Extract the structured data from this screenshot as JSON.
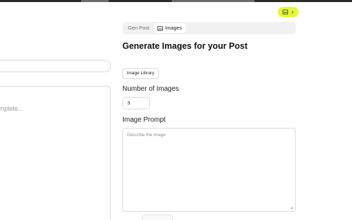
{
  "left": {
    "textarea_placeholder": "mplete..."
  },
  "tabs": [
    {
      "label": "Gen Post"
    },
    {
      "label": "Images"
    }
  ],
  "main": {
    "title": "Generate Images for your Post",
    "library_button": "Image Library",
    "num_images_label": "Number of Images",
    "num_images_value": "3",
    "prompt_label": "Image Prompt",
    "prompt_placeholder": "Describe the image"
  },
  "toggle": {
    "icon": "image-icon",
    "chevron": "›",
    "color": "#e6f73a"
  }
}
